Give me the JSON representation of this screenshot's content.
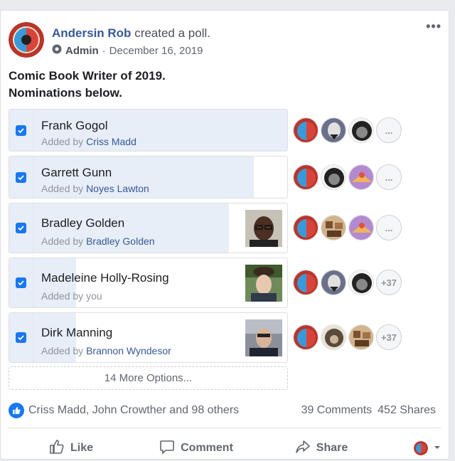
{
  "post": {
    "author": "Andersin Rob",
    "action": "created a poll.",
    "role": "Admin",
    "date": "December 16, 2019",
    "text_line1": "Comic Book Writer of 2019.",
    "text_line2": "Nominations below.",
    "more_label": "•••"
  },
  "poll": {
    "added_by_label": "Added by",
    "options": [
      {
        "name": "Frank Gogol",
        "added_by": "Criss Madd",
        "progress": 1.0,
        "voters_more": "..."
      },
      {
        "name": "Garrett Gunn",
        "added_by": "Noyes Lawton",
        "progress": 0.88,
        "voters_more": "..."
      },
      {
        "name": "Bradley Golden",
        "added_by": "Bradley Golden",
        "progress": 0.79,
        "voters_more": "..."
      },
      {
        "name": "Madeleine Holly-Rosing",
        "added_by": "you",
        "progress": 0.24,
        "voters_more": "+37"
      },
      {
        "name": "Dirk Manning",
        "added_by": "Brannon Wyndesor",
        "progress": 0.24,
        "voters_more": "+37"
      }
    ],
    "more_options": "14 More Options..."
  },
  "footer": {
    "reactions_text": "Criss Madd, John Crowther and 98 others",
    "comments": "39 Comments",
    "shares": "452 Shares",
    "like_label": "Like",
    "comment_label": "Comment",
    "share_label": "Share"
  },
  "colors": {
    "brand_blue": "#1877f2",
    "link_blue": "#365899",
    "progress_fill": "#e7eef8"
  }
}
